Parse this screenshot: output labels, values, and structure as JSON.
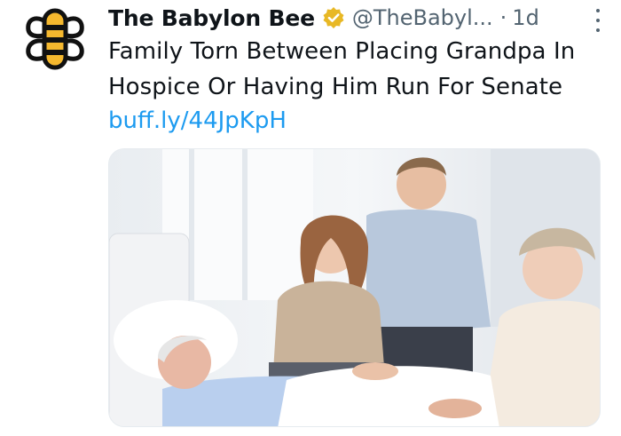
{
  "tweet": {
    "display_name": "The Babylon Bee",
    "handle": "@TheBabyl...",
    "separator": "·",
    "time": "1d",
    "text": "Family Torn Between Placing Grandpa In Hospice Or Having Him Run For Senate",
    "link": "buff.ly/44JpKpH"
  },
  "icons": {
    "avatar": "babylon-bee-logo",
    "verified": "verified-badge-icon",
    "more": "more-options-icon"
  },
  "colors": {
    "link": "#1d9bf0",
    "secondary_text": "#536471",
    "verified_gold": "#e8b825",
    "bee_yellow": "#f5b82e"
  }
}
